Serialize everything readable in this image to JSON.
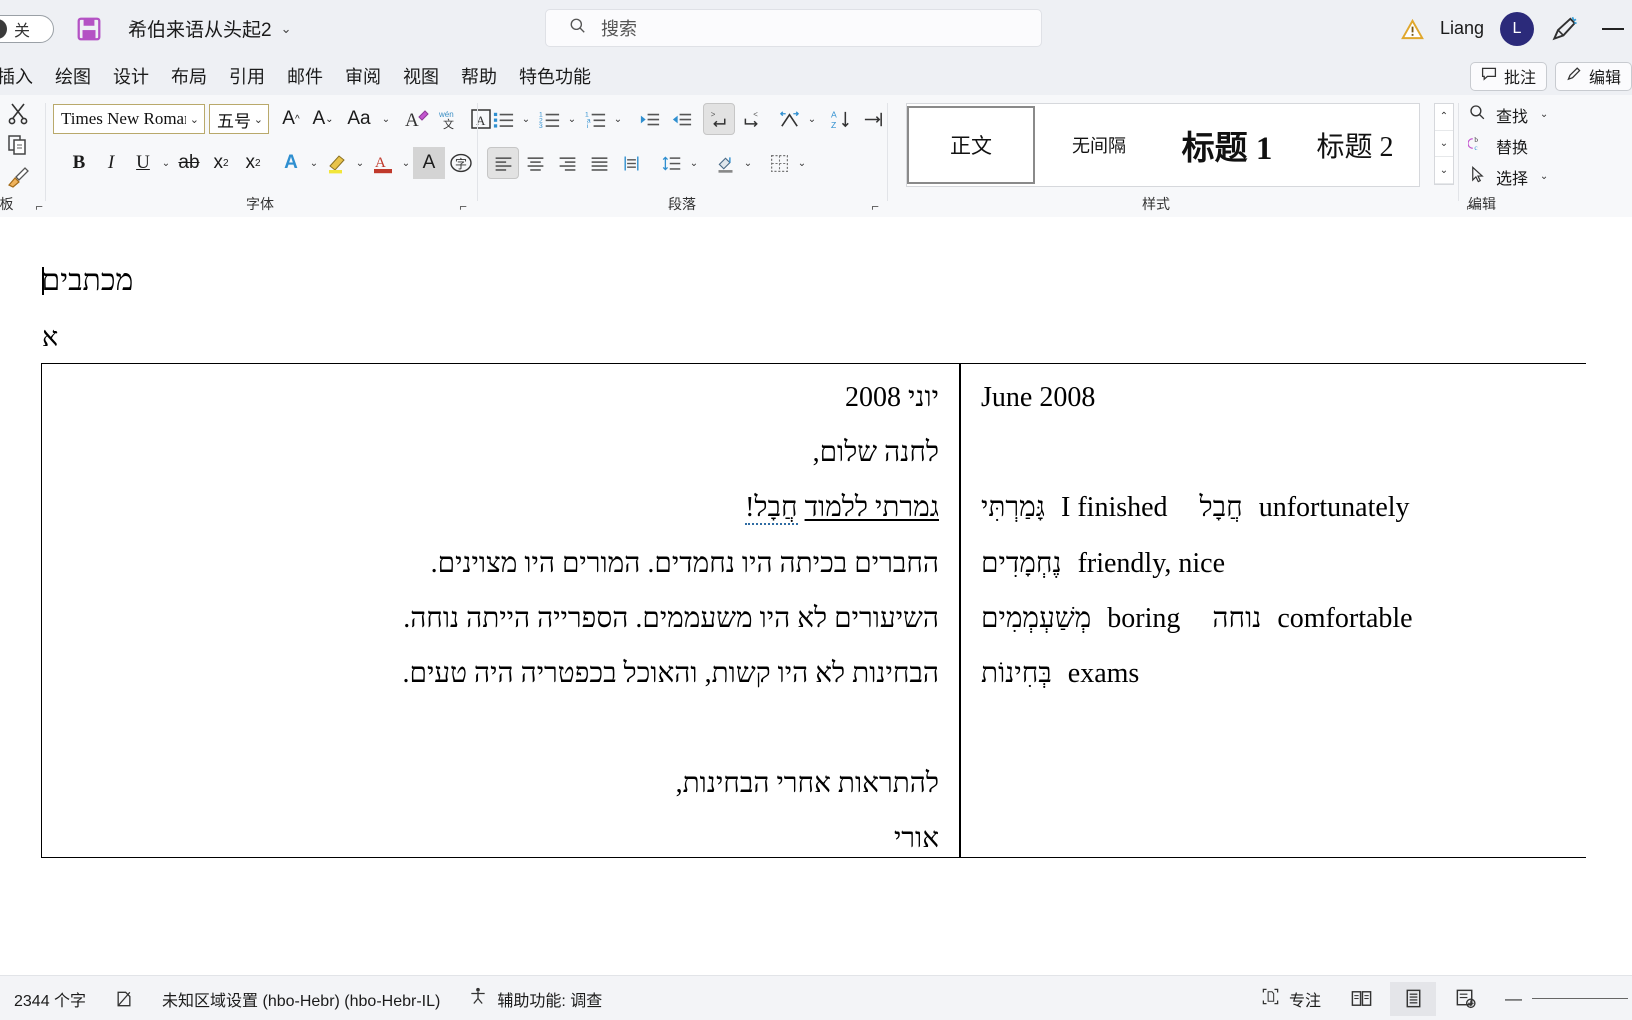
{
  "titlebar": {
    "autosave_label": "关",
    "autosave_icon": "toggle-off-icon",
    "save_icon": "save-disk-icon",
    "document_title": "希伯来语从头起2",
    "title_chevron": "⌄",
    "search_placeholder": "搜索",
    "search_icon": "search-icon",
    "warning_icon": "warning-triangle-icon",
    "user_name": "Liang",
    "avatar_initial": "L",
    "pen_icon": "pen-sparkle-icon",
    "minimize_label": "—"
  },
  "tabs": [
    {
      "label": "插入"
    },
    {
      "label": "绘图"
    },
    {
      "label": "设计"
    },
    {
      "label": "布局"
    },
    {
      "label": "引用"
    },
    {
      "label": "邮件"
    },
    {
      "label": "审阅"
    },
    {
      "label": "视图"
    },
    {
      "label": "帮助"
    },
    {
      "label": "特色功能"
    }
  ],
  "tab_right": {
    "comments_label": "批注",
    "comments_icon": "comment-icon",
    "editing_label": "编辑",
    "editing_icon": "pencil-icon"
  },
  "ribbon": {
    "clipboard": {
      "cut_icon": "scissors-icon",
      "copy_icon": "copy-icon",
      "format_painter_icon": "format-painter-icon",
      "label": "板",
      "launcher": "⌐"
    },
    "font": {
      "label": "字体",
      "font_name": "Times New Romar",
      "font_size": "五号",
      "grow_font_icon": "grow-font-icon",
      "shrink_font_icon": "shrink-font-icon",
      "change_case_icon": "change-case-icon",
      "clear_format_icon": "clear-formatting-icon",
      "phonetic_icon": "phonetic-guide-icon",
      "char_border_icon": "character-border-icon",
      "bold_icon": "bold-icon",
      "italic_icon": "italic-icon",
      "underline_icon": "underline-icon",
      "strikethrough_icon": "strikethrough-icon",
      "subscript_icon": "subscript-icon",
      "superscript_icon": "superscript-icon",
      "text_effects_icon": "text-effects-icon",
      "highlight_icon": "highlight-color-icon",
      "font_color_icon": "font-color-icon",
      "char_shading_icon": "character-shading-icon",
      "enclose_char_icon": "enclose-character-icon",
      "launcher": "⌐"
    },
    "paragraph": {
      "label": "段落",
      "bullets_icon": "bullet-list-icon",
      "numbering_icon": "numbered-list-icon",
      "multilevel_icon": "multilevel-list-icon",
      "decrease_indent_icon": "decrease-indent-icon",
      "increase_indent_icon": "increase-indent-icon",
      "rtl_text_icon": "rtl-direction-icon",
      "ltr_text_icon": "ltr-direction-icon",
      "asian_layout_icon": "asian-layout-icon",
      "sort_icon": "sort-icon",
      "show_marks_icon": "show-paragraph-marks-icon",
      "align_left_icon": "align-left-icon",
      "align_center_icon": "align-center-icon",
      "align_right_icon": "align-right-icon",
      "justify_icon": "justify-icon",
      "distribute_icon": "distribute-icon",
      "line_spacing_icon": "line-spacing-icon",
      "shading_icon": "shading-icon",
      "borders_icon": "borders-icon",
      "launcher": "⌐"
    },
    "styles": {
      "label": "样式",
      "items": [
        {
          "name": "正文",
          "active": true
        },
        {
          "name": "无间隔",
          "active": false
        },
        {
          "name": "标题 1",
          "active": false
        },
        {
          "name": "标题 2",
          "active": false
        }
      ],
      "scroll_up": "⌃",
      "scroll_down": "⌄",
      "more": "⌄",
      "launcher": "⌐"
    },
    "editing": {
      "label": "编辑",
      "find_label": "查找",
      "find_icon": "search-icon",
      "replace_label": "替换",
      "replace_icon": "replace-icon",
      "select_label": "选择",
      "select_icon": "pointer-icon",
      "caret": "⌄"
    }
  },
  "document": {
    "heading": "מכתבים",
    "section_mark": "א",
    "left_cell": {
      "date_line": "יוני 2008",
      "greeting": "לחנה שלום,",
      "line_highlight_a": "גמרתי ללמוד",
      "line_highlight_b": "חֲבָל!",
      "body": [
        "החברים בכיתה היו נחמדים. המורים היו מצוינים.",
        "השיעורים לא היו משעממים. הספרייה הייתה נוחה.",
        "הבחינות לא היו קשות, והאוכל בכפטריה היה טעים."
      ],
      "closing": "להתראות אחרי הבחינות,",
      "signature": "אורי"
    },
    "right_cell": {
      "date_line": "June 2008",
      "glossary": [
        [
          {
            "hebrew": "גָּמַרְתִּי",
            "english": "I finished"
          },
          {
            "hebrew": "חֲבָל",
            "english": "unfortunately"
          }
        ],
        [
          {
            "hebrew": "נֶחְמָדִים",
            "english": "friendly, nice"
          }
        ],
        [
          {
            "hebrew": "מְשַׁעְמְמִים",
            "english": "boring"
          },
          {
            "hebrew": "נוחה",
            "english": "comfortable"
          }
        ],
        [
          {
            "hebrew": "בְּחִינוֹת",
            "english": "exams"
          }
        ]
      ]
    }
  },
  "statusbar": {
    "word_count": "2344 个字",
    "proofing_icon": "proofing-icon",
    "language": "未知区域设置 (hbo-Hebr) (hbo-Hebr-IL)",
    "accessibility_icon": "accessibility-icon",
    "accessibility_label": "辅助功能: 调查",
    "focus_icon": "focus-icon",
    "focus_label": "专注",
    "read_mode_icon": "read-mode-icon",
    "print_layout_icon": "print-layout-icon",
    "web_layout_icon": "web-layout-icon",
    "zoom_out": "—",
    "zoom_in": "+"
  },
  "colors": {
    "chrome": "#eef0f4",
    "ribbon": "#f7f8fa",
    "accent_purple": "#b452c4",
    "avatar": "#2b2a7a",
    "accent_blue": "#2f6ca3"
  }
}
